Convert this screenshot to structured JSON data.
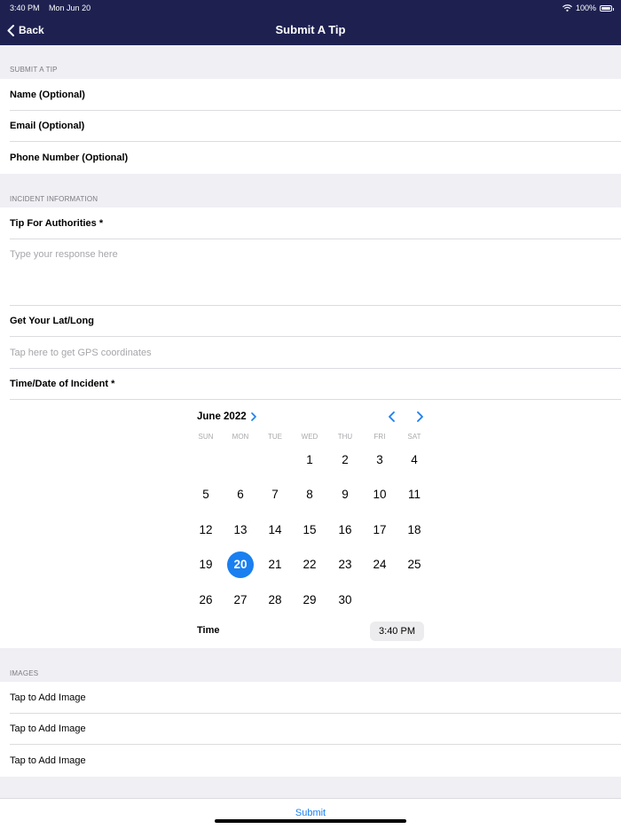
{
  "status_bar": {
    "time": "3:40 PM",
    "date": "Mon Jun 20",
    "battery": "100%",
    "battery_level": 1.0
  },
  "nav": {
    "back_label": "Back",
    "title": "Submit A Tip"
  },
  "submit_section": {
    "header": "SUBMIT A TIP",
    "rows": [
      "Name (Optional)",
      "Email (Optional)",
      "Phone Number (Optional)"
    ]
  },
  "incident_section": {
    "header": "INCIDENT INFORMATION",
    "tip_label": "Tip For Authorities *",
    "tip_placeholder": "Type your response here",
    "latlong_label": "Get Your Lat/Long",
    "gps_placeholder": "Tap here to get GPS coordinates",
    "datetime_label": "Time/Date of Incident *"
  },
  "calendar": {
    "month_label": "June 2022",
    "weekdays": [
      "SUN",
      "MON",
      "TUE",
      "WED",
      "THU",
      "FRI",
      "SAT"
    ],
    "weeks": [
      [
        "",
        "",
        "",
        "1",
        "2",
        "3",
        "4"
      ],
      [
        "5",
        "6",
        "7",
        "8",
        "9",
        "10",
        "11"
      ],
      [
        "12",
        "13",
        "14",
        "15",
        "16",
        "17",
        "18"
      ],
      [
        "19",
        "20",
        "21",
        "22",
        "23",
        "24",
        "25"
      ],
      [
        "26",
        "27",
        "28",
        "29",
        "30",
        "",
        ""
      ]
    ],
    "selected_day": "20",
    "time_label": "Time",
    "time_value": "3:40 PM",
    "accent": "#1a7ff0"
  },
  "images_section": {
    "header": "IMAGES",
    "rows": [
      "Tap to Add Image",
      "Tap to Add Image",
      "Tap to Add Image"
    ]
  },
  "footer": {
    "submit_label": "Submit"
  },
  "colors": {
    "nav_bg": "#1e2150",
    "accent": "#1a7ff0",
    "background": "#efeff4"
  }
}
